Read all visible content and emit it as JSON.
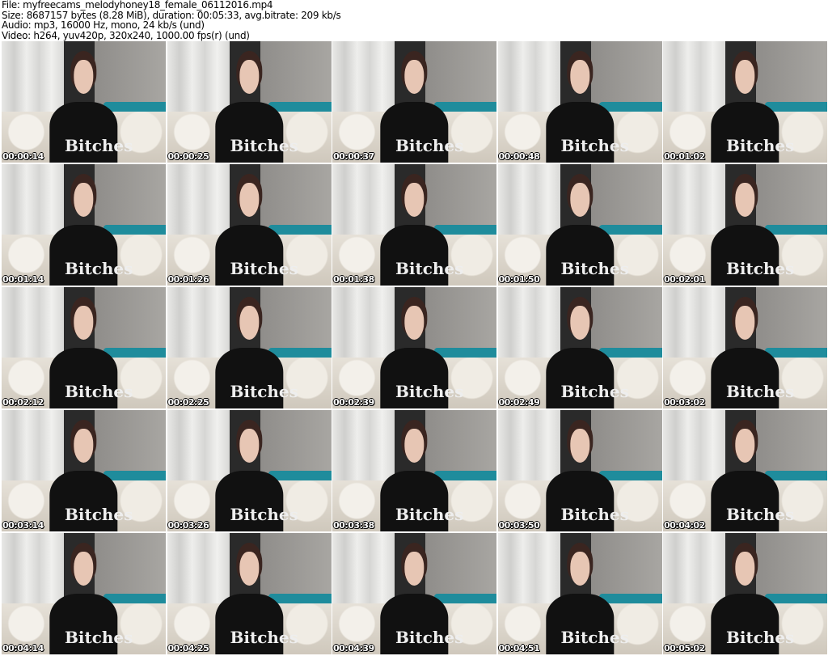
{
  "header": {
    "file": "File: myfreecams_melodyhoney18_female_06112016.mp4",
    "size": "Size: 8687157 bytes (8.28 MiB), duration: 00:05:33, avg.bitrate: 209 kb/s",
    "audio": "Audio: mp3, 16000 Hz, mono, 24 kb/s (und)",
    "video": "Video: h264, yuv420p, 320x240, 1000.00 fps(r) (und)"
  },
  "shirt_text": "Bitches",
  "thumbnails": [
    "00:00:14",
    "00:00:25",
    "00:00:37",
    "00:00:48",
    "00:01:02",
    "00:01:14",
    "00:01:26",
    "00:01:38",
    "00:01:50",
    "00:02:01",
    "00:02:12",
    "00:02:25",
    "00:02:39",
    "00:02:49",
    "00:03:02",
    "00:03:14",
    "00:03:26",
    "00:03:38",
    "00:03:50",
    "00:04:02",
    "00:04:14",
    "00:04:25",
    "00:04:39",
    "00:04:51",
    "00:05:02"
  ]
}
